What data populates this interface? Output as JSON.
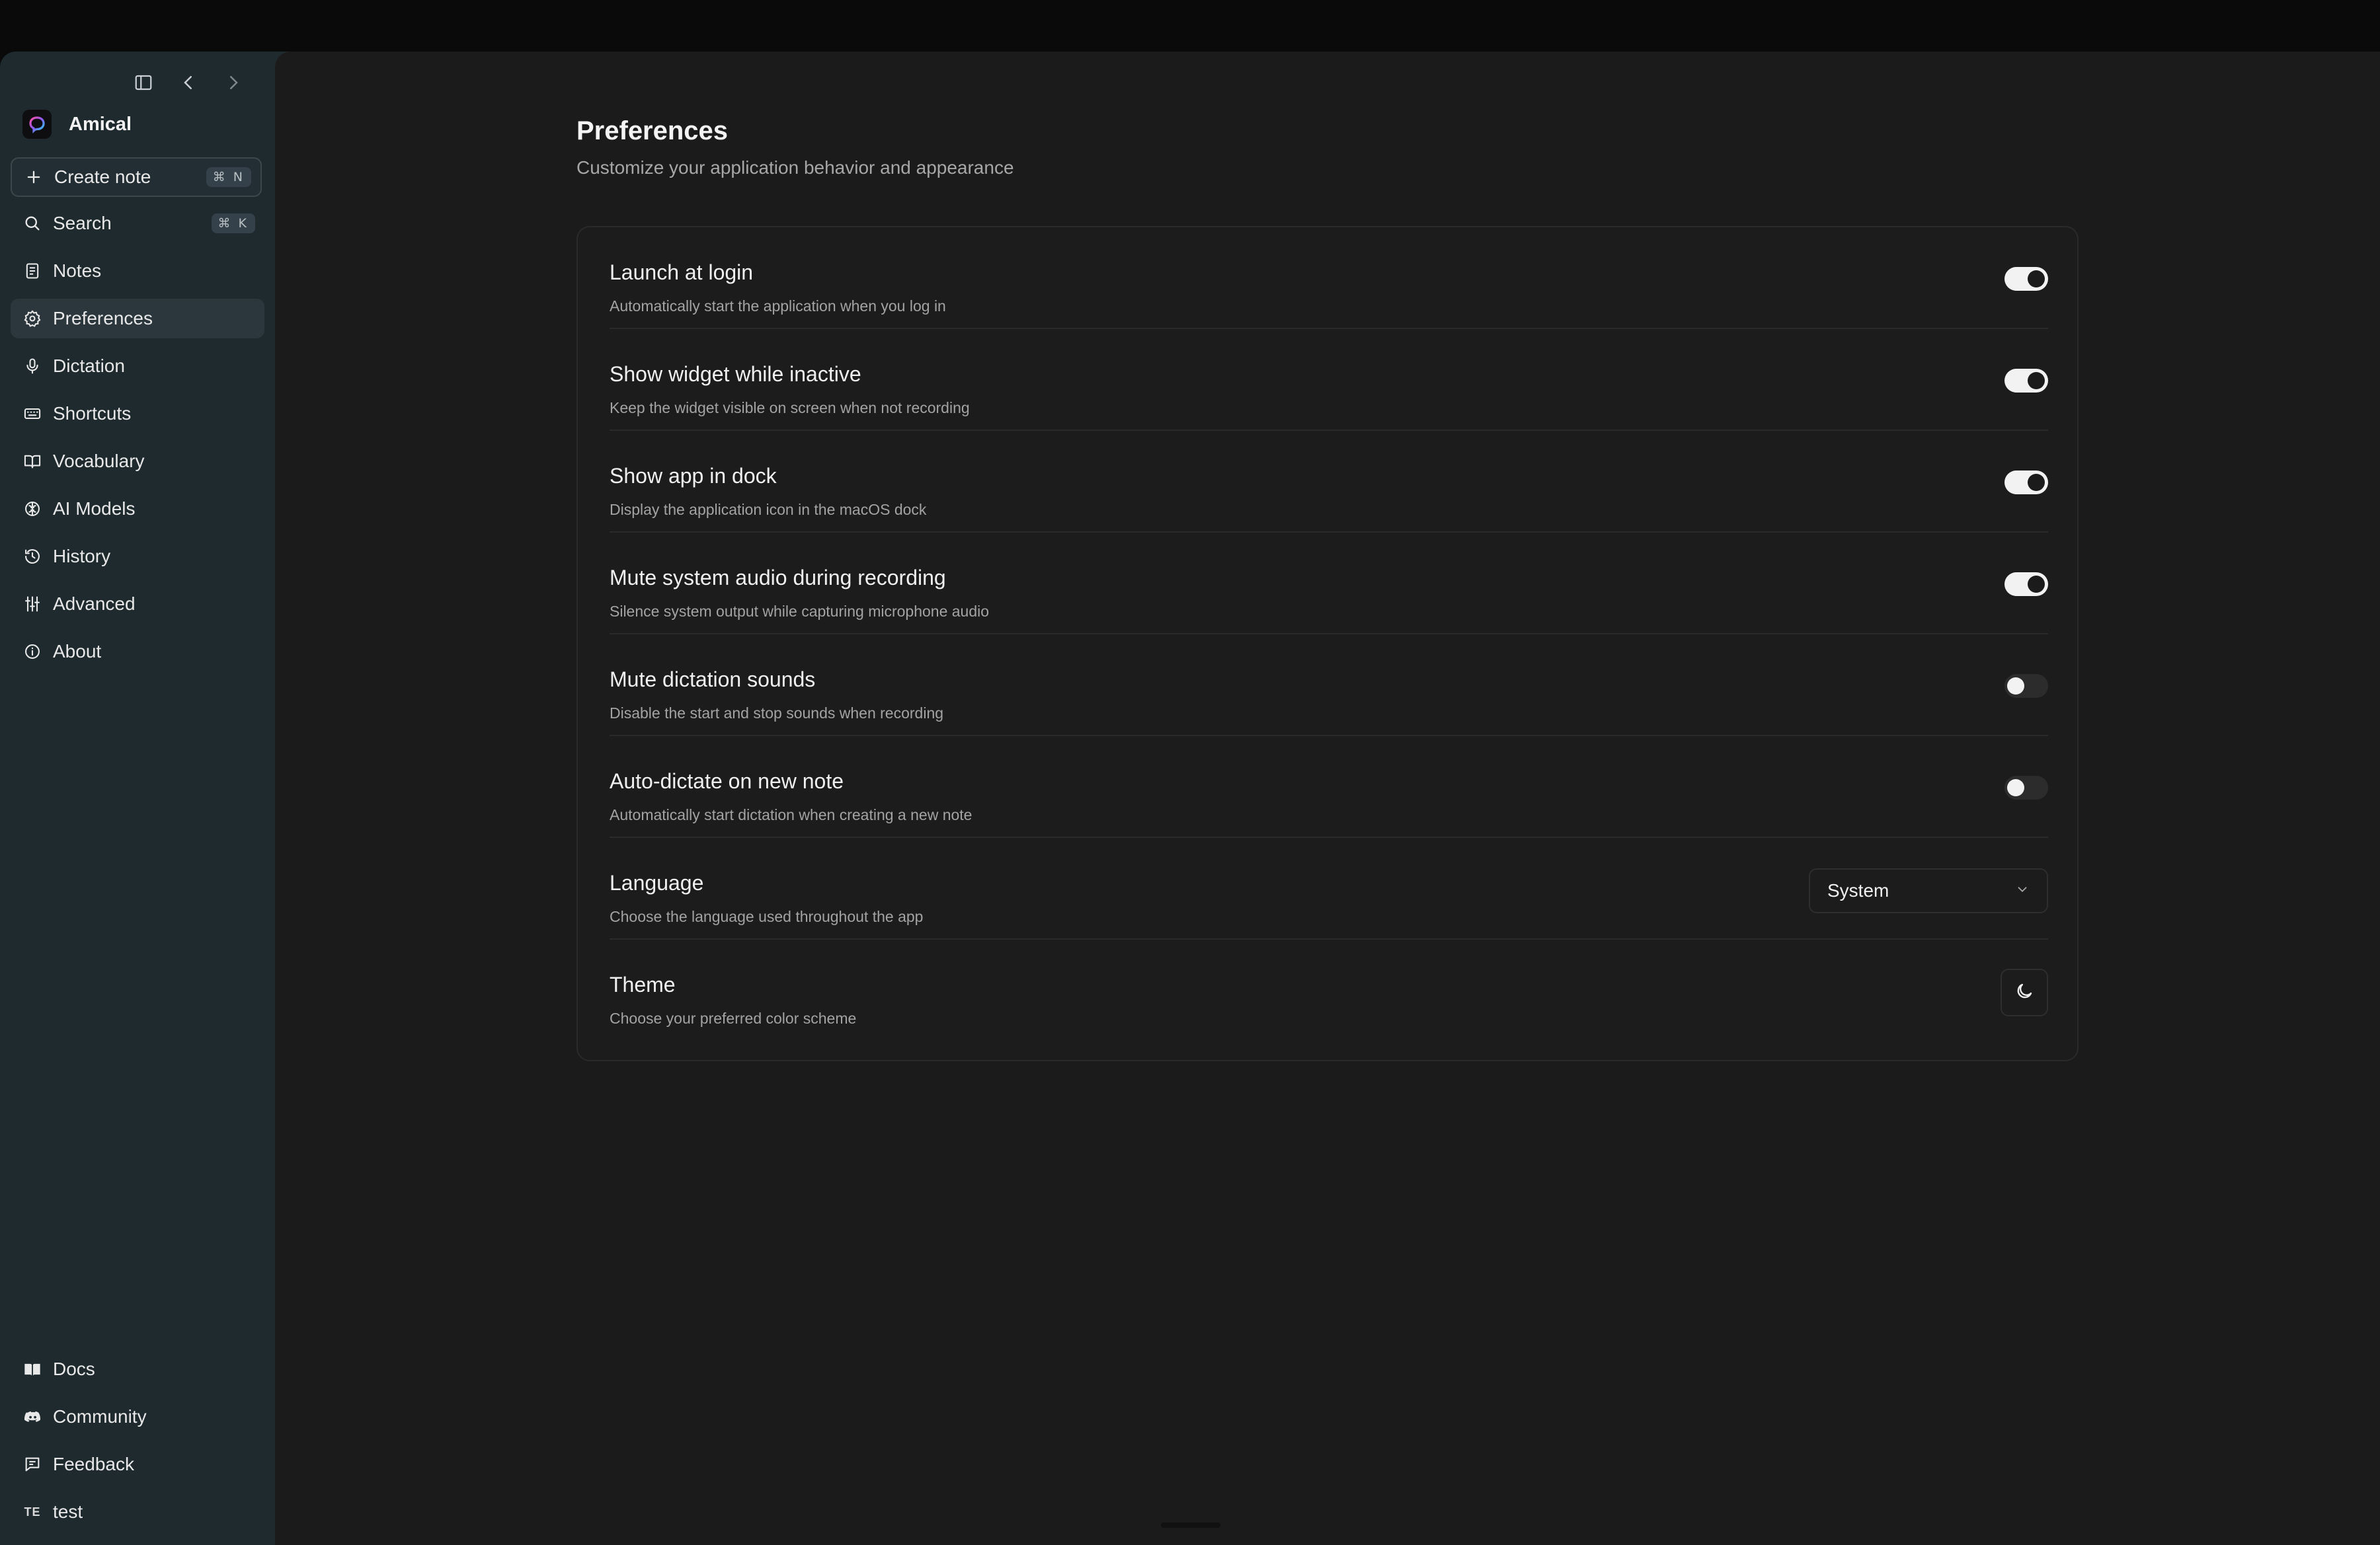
{
  "app": {
    "name": "Amical"
  },
  "sidebar": {
    "create_note": {
      "label": "Create note",
      "shortcut": "⌘ N"
    },
    "search": {
      "label": "Search",
      "shortcut": "⌘ K"
    },
    "items": [
      {
        "label": "Notes",
        "icon": "notes-icon"
      },
      {
        "label": "Preferences",
        "icon": "gear-icon",
        "active": true
      },
      {
        "label": "Dictation",
        "icon": "microphone-icon"
      },
      {
        "label": "Shortcuts",
        "icon": "keyboard-icon"
      },
      {
        "label": "Vocabulary",
        "icon": "book-open-icon"
      },
      {
        "label": "AI Models",
        "icon": "brain-icon"
      },
      {
        "label": "History",
        "icon": "history-icon"
      },
      {
        "label": "Advanced",
        "icon": "sliders-icon"
      },
      {
        "label": "About",
        "icon": "info-icon"
      }
    ],
    "footer": [
      {
        "label": "Docs",
        "icon": "book-icon"
      },
      {
        "label": "Community",
        "icon": "discord-icon"
      },
      {
        "label": "Feedback",
        "icon": "feedback-icon"
      }
    ],
    "user": {
      "initials": "TE",
      "name": "test"
    }
  },
  "main": {
    "title": "Preferences",
    "subtitle": "Customize your application behavior and appearance",
    "settings": [
      {
        "title": "Launch at login",
        "description": "Automatically start the application when you log in",
        "control": "toggle",
        "enabled": true
      },
      {
        "title": "Show widget while inactive",
        "description": "Keep the widget visible on screen when not recording",
        "control": "toggle",
        "enabled": true
      },
      {
        "title": "Show app in dock",
        "description": "Display the application icon in the macOS dock",
        "control": "toggle",
        "enabled": true
      },
      {
        "title": "Mute system audio during recording",
        "description": "Silence system output while capturing microphone audio",
        "control": "toggle",
        "enabled": true
      },
      {
        "title": "Mute dictation sounds",
        "description": "Disable the start and stop sounds when recording",
        "control": "toggle",
        "enabled": false
      },
      {
        "title": "Auto-dictate on new note",
        "description": "Automatically start dictation when creating a new note",
        "control": "toggle",
        "enabled": false
      },
      {
        "title": "Language",
        "description": "Choose the language used throughout the app",
        "control": "select",
        "value": "System"
      },
      {
        "title": "Theme",
        "description": "Choose your preferred color scheme",
        "control": "theme-button",
        "icon": "moon-icon"
      }
    ]
  },
  "colors": {
    "sidebar_bg": "#1f2a2f",
    "main_bg": "#1b1b1b",
    "toggle_on": "#f2f2f2",
    "toggle_off": "#2c2c2c"
  }
}
